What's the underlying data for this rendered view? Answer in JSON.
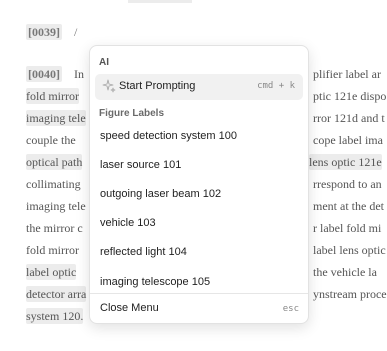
{
  "document": {
    "para_39_number": "[0039]",
    "para_39_text": "/",
    "para_40_number": "[0040]",
    "lines": [
      {
        "left": "In",
        "right": "plifier label ar"
      },
      {
        "left": "fold mirror",
        "right": "ptic 121e  dispo"
      },
      {
        "left": "imaging tele",
        "right": "rror 121d and t"
      },
      {
        "left": "couple the",
        "right": "cope label ima"
      },
      {
        "left": "optical path",
        "right": "lens optic 121e"
      },
      {
        "left": "collimating",
        "right": "rrespond to an"
      },
      {
        "left": "imaging tele",
        "right": "ment at the det"
      },
      {
        "left": "the mirror c",
        "right": "r label fold mi"
      },
      {
        "left": "fold mirror",
        "right": "label lens optic"
      },
      {
        "left": "label  optic",
        "right": "the  vehicle  la"
      },
      {
        "left": "detector arra",
        "right": "ynstream proces"
      },
      {
        "left": "system 120.",
        "right": ""
      }
    ]
  },
  "menu": {
    "ai_section_label": "AI",
    "start_prompting_label": "Start Prompting",
    "start_prompting_shortcut": "cmd + k",
    "figure_labels_section_label": "Figure Labels",
    "figure_labels": [
      "speed detection system 100",
      "laser source 101",
      "outgoing laser beam 102",
      "vehicle 103",
      "reflected light 104",
      "imaging telescope 105"
    ],
    "close_label": "Close Menu",
    "close_shortcut": "esc"
  },
  "icons": {
    "start_prompting": "sparkle-icon"
  }
}
